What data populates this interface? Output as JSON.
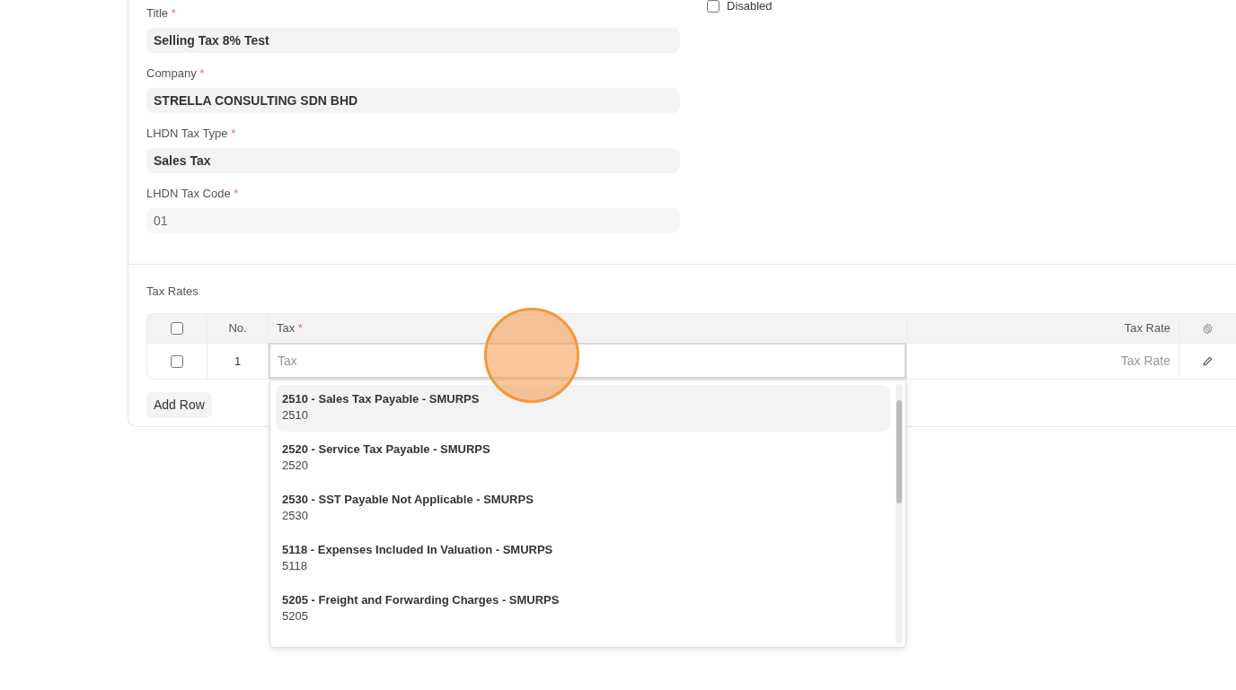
{
  "form": {
    "fields": [
      {
        "label": "Title",
        "required_mark": "*",
        "value": "Selling Tax 8% Test",
        "readonly": false
      },
      {
        "label": "Company",
        "required_mark": "*",
        "value": "STRELLA CONSULTING SDN BHD",
        "readonly": false
      },
      {
        "label": "LHDN Tax Type",
        "required_mark": "*",
        "value": "Sales Tax",
        "readonly": false
      },
      {
        "label": "LHDN Tax Code",
        "required_mark": "*",
        "value": "01",
        "readonly": true
      }
    ],
    "disabled_checkbox": {
      "label": "Disabled",
      "checked": false
    }
  },
  "tax_rates": {
    "label": "Tax Rates",
    "columns": [
      {
        "label": "No."
      },
      {
        "label": "Tax",
        "required_mark": "*"
      },
      {
        "label": "Tax Rate"
      }
    ],
    "select_all_checked": false,
    "rows": [
      {
        "checked": false,
        "no": "1",
        "tax_placeholder": "Tax",
        "tax_rate_placeholder": "Tax Rate"
      }
    ],
    "add_row": "Add Row",
    "dropdown": [
      {
        "title": "2510 - Sales Tax Payable - SMURPS",
        "subtitle": "2510",
        "selected": true
      },
      {
        "title": "2520 - Service Tax Payable - SMURPS",
        "subtitle": "2520",
        "selected": false
      },
      {
        "title": "2530 - SST Payable Not Applicable - SMURPS",
        "subtitle": "2530",
        "selected": false
      },
      {
        "title": "5118 - Expenses Included In Valuation - SMURPS",
        "subtitle": "5118",
        "selected": false
      },
      {
        "title": "5205 - Freight and Forwarding Charges - SMURPS",
        "subtitle": "5205",
        "selected": false
      }
    ]
  }
}
